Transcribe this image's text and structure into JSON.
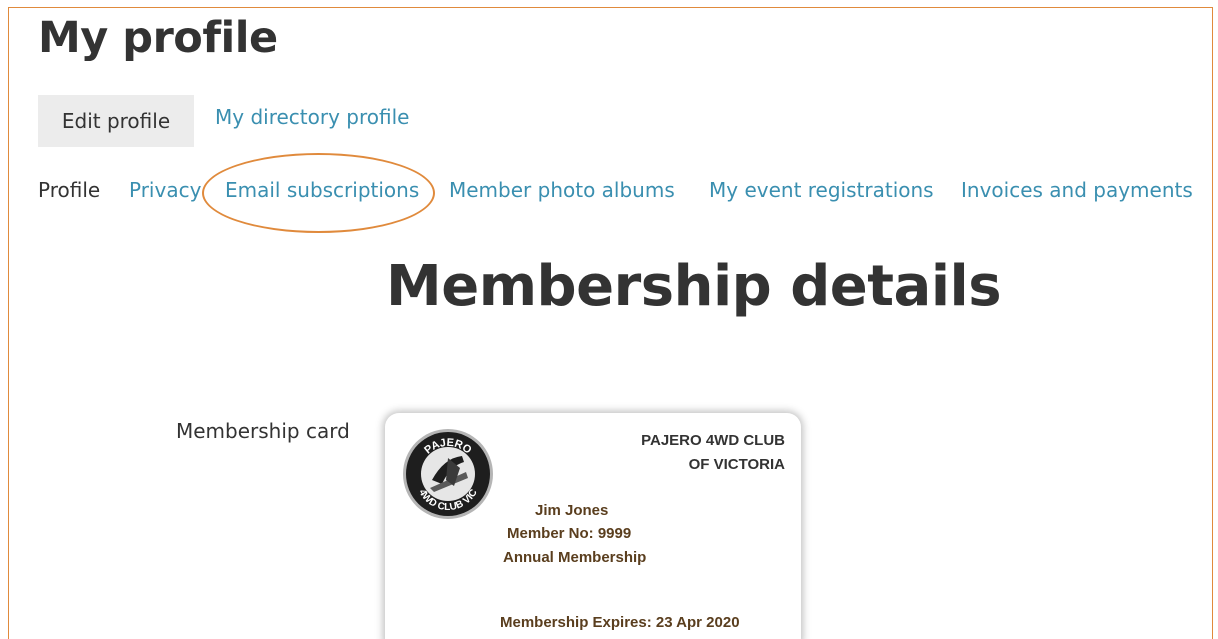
{
  "header": {
    "title": "My profile"
  },
  "actions": {
    "edit_profile_label": "Edit profile",
    "directory_profile_label": "My directory profile"
  },
  "tabs": [
    {
      "label": "Profile",
      "active": true
    },
    {
      "label": "Privacy",
      "active": false
    },
    {
      "label": "Email subscriptions",
      "active": false,
      "highlighted": true
    },
    {
      "label": "Member photo albums",
      "active": false
    },
    {
      "label": "My event registrations",
      "active": false
    },
    {
      "label": "Invoices and payments",
      "active": false
    }
  ],
  "main": {
    "heading": "Membership details",
    "card_field_label": "Membership card"
  },
  "card": {
    "club_name_line1": "PAJERO 4WD CLUB",
    "club_name_line2": "OF VICTORIA",
    "member_name": "Jim Jones",
    "member_no": "Member No: 9999",
    "membership_type": "Annual Membership",
    "expiry": "Membership Expires: 23 Apr 2020",
    "logo_text_top": "PAJERO",
    "logo_text_bottom": "4WD CLUB VIC"
  },
  "colors": {
    "link": "#3a8fb0",
    "text": "#333333",
    "annotation": "#e08a3c",
    "button_bg": "#ececec",
    "card_text": "#5a3e1e"
  }
}
